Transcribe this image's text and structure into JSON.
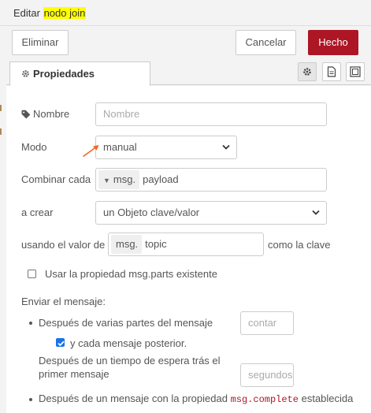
{
  "title": {
    "prefix": "Editar ",
    "highlight": "nodo join"
  },
  "toolbar": {
    "delete_label": "Eliminar",
    "cancel_label": "Cancelar",
    "done_label": "Hecho"
  },
  "tabs": {
    "properties_label": "Propiedades"
  },
  "form": {
    "name_label": "Nombre",
    "name_placeholder": "Nombre",
    "mode_label": "Modo",
    "mode_value": "manual",
    "combine_label": "Combinar cada",
    "combine_prefix": "msg.",
    "combine_value": "payload",
    "create_label": "a crear",
    "create_value": "un Objeto clave/valor",
    "using_label": "usando el valor de",
    "using_prefix": "msg.",
    "using_value": "topic",
    "using_suffix": "como la clave",
    "use_parts_label": "Usar la propiedad msg.parts existente",
    "send_label": "Enviar el mensaje:",
    "after_parts_label": "Después de varias partes del mensaje",
    "count_placeholder": "contar",
    "each_subsequent_label": "y cada mensaje posterior.",
    "after_timeout_label_1": "Después de un tiempo de espera trás el",
    "after_timeout_label_2": "primer mensaje",
    "seconds_placeholder": "segundos",
    "after_complete_prefix": "Después de un mensaje con la propiedad ",
    "after_complete_code": "msg.complete",
    "after_complete_suffix": " establecida"
  },
  "colors": {
    "accent": "#ad1625",
    "highlight": "#ffff00",
    "arrow": "#f26522",
    "checkbox": "#1a73e8"
  },
  "icons": [
    "gear-icon",
    "tag-icon",
    "document-icon",
    "layout-icon",
    "chevron-down-icon",
    "caret-down-icon",
    "arrow-annotation"
  ]
}
